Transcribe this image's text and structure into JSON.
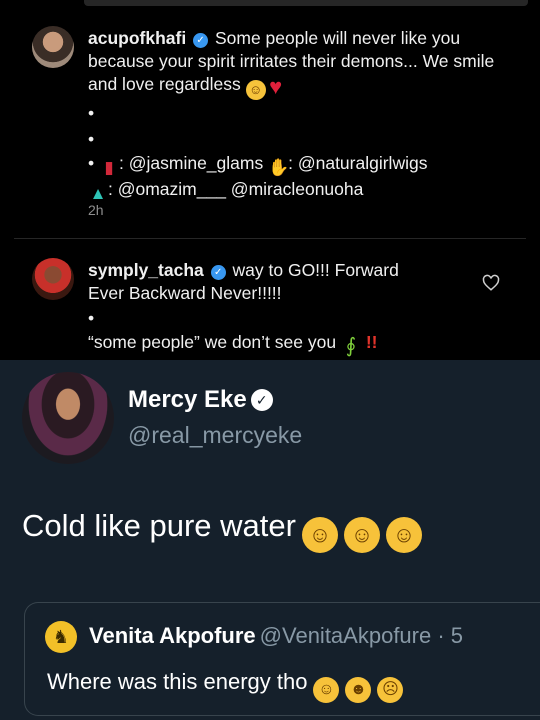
{
  "instagram": {
    "comments": [
      {
        "username": "acupofkhafi",
        "text": "Some people will never like you because your spirit irritates their demons... We smile and love regardless",
        "bullets": [
          "•",
          "•",
          "•"
        ],
        "credits_line1_a": ": @jasmine_glams",
        "credits_line1_b": ": @naturalgirlwigs",
        "credits_line2": ": @omazim___ @miracleonuoha",
        "time": "2h",
        "icons": [
          "smiling-face-emoji",
          "red-heart-emoji",
          "lipstick-emoji",
          "nail-polish-emoji",
          "dress-emoji"
        ]
      },
      {
        "username": "symply_tacha",
        "text_line1": "way to GO!!! Forward",
        "text_line2": "Ever Backward Never!!!!!",
        "bullet": "•",
        "text_line3": "“some people” we don’t see you",
        "exclaim": "!!",
        "icons": [
          "lizard-emoji",
          "heart-outline-icon"
        ]
      }
    ]
  },
  "twitter": {
    "name": "Mercy Eke",
    "handle": "@real_mercyeke",
    "tweet": "Cold like pure water",
    "tweet_emoji_count": 3,
    "quote": {
      "name": "Venita Akpofure",
      "handle": "@VenitaAkpofure · 5",
      "text": "Where was this energy tho",
      "emojis": [
        "joy-emoji",
        "rofl-emoji",
        "weary-emoji"
      ]
    },
    "colors": {
      "background": "#15202b",
      "secondary_text": "#8899a6",
      "border": "#38444d"
    }
  }
}
